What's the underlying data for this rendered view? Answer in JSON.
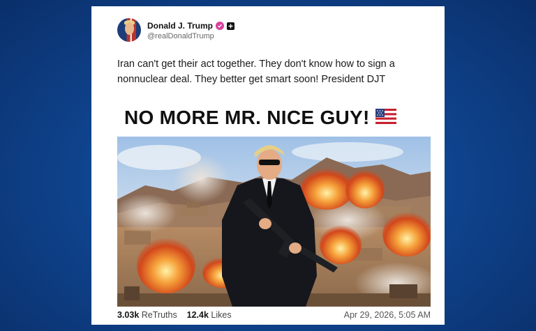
{
  "post": {
    "author_name": "Donald J. Trump",
    "handle": "@realDonaldTrump",
    "text": "Iran can't get their act together. They don't know how to sign a nonnuclear deal. They better get smart soon! President DJT",
    "headline": "NO MORE MR. NICE GUY!",
    "headline_icon": "us-flag-emoji",
    "image_description_icon": "man-in-suit-with-rifle-explosions-image",
    "retruths_count": "3.03k",
    "retruths_label": "ReTruths",
    "likes_count": "12.4k",
    "likes_label": "Likes",
    "timestamp": "Apr 29, 2026, 5:05 AM"
  },
  "colors": {
    "verified_badge": "#d9409b",
    "background": "#0f4590"
  }
}
